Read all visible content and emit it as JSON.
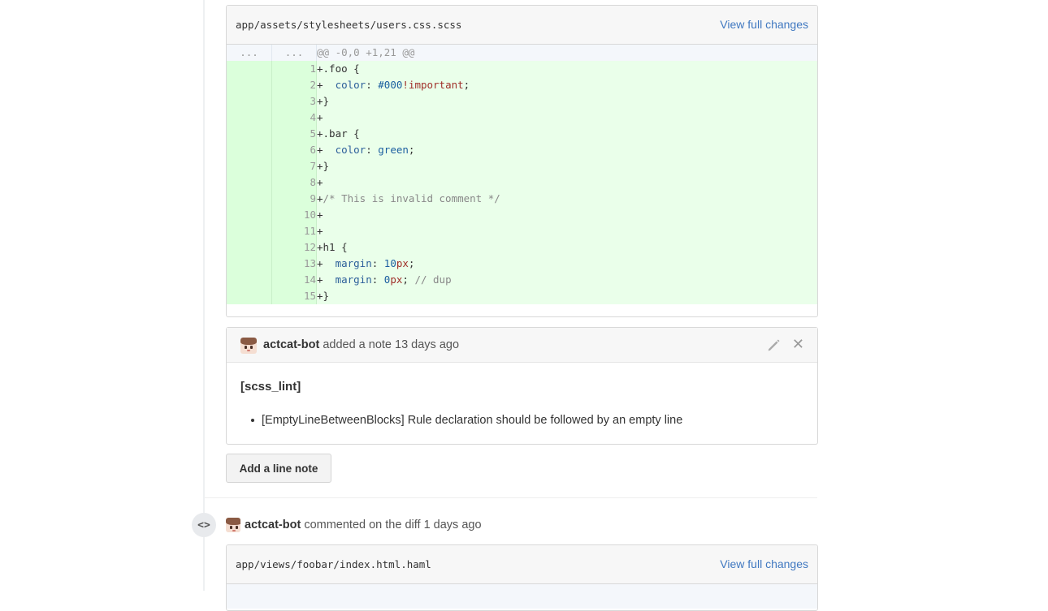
{
  "file1": {
    "path": "app/assets/stylesheets/users.css.scss",
    "view_link": "View full changes",
    "hunk": {
      "old": "...",
      "new": "...",
      "text": "@@ -0,0 +1,21 @@"
    },
    "lines": [
      {
        "num": "1",
        "tokens": [
          {
            "t": "+.foo {",
            "c": ""
          }
        ]
      },
      {
        "num": "2",
        "tokens": [
          {
            "t": "+  ",
            "c": ""
          },
          {
            "t": "color",
            "c": "k"
          },
          {
            "t": ": ",
            "c": ""
          },
          {
            "t": "#000",
            "c": "n"
          },
          {
            "t": "!important",
            "c": "imp"
          },
          {
            "t": ";",
            "c": ""
          }
        ]
      },
      {
        "num": "3",
        "tokens": [
          {
            "t": "+}",
            "c": ""
          }
        ]
      },
      {
        "num": "4",
        "tokens": [
          {
            "t": "+",
            "c": ""
          }
        ]
      },
      {
        "num": "5",
        "tokens": [
          {
            "t": "+.bar {",
            "c": ""
          }
        ]
      },
      {
        "num": "6",
        "tokens": [
          {
            "t": "+  ",
            "c": ""
          },
          {
            "t": "color",
            "c": "k"
          },
          {
            "t": ": ",
            "c": ""
          },
          {
            "t": "green",
            "c": "n"
          },
          {
            "t": ";",
            "c": ""
          }
        ]
      },
      {
        "num": "7",
        "tokens": [
          {
            "t": "+}",
            "c": ""
          }
        ]
      },
      {
        "num": "8",
        "tokens": [
          {
            "t": "+",
            "c": ""
          }
        ]
      },
      {
        "num": "9",
        "tokens": [
          {
            "t": "+",
            "c": ""
          },
          {
            "t": "/* This is invalid comment */",
            "c": "cm"
          }
        ]
      },
      {
        "num": "10",
        "tokens": [
          {
            "t": "+",
            "c": ""
          }
        ]
      },
      {
        "num": "11",
        "tokens": [
          {
            "t": "+",
            "c": ""
          }
        ]
      },
      {
        "num": "12",
        "tokens": [
          {
            "t": "+h1 {",
            "c": ""
          }
        ]
      },
      {
        "num": "13",
        "tokens": [
          {
            "t": "+  ",
            "c": ""
          },
          {
            "t": "margin",
            "c": "k"
          },
          {
            "t": ": ",
            "c": ""
          },
          {
            "t": "10",
            "c": "n"
          },
          {
            "t": "px",
            "c": "imp"
          },
          {
            "t": ";",
            "c": ""
          }
        ]
      },
      {
        "num": "14",
        "tokens": [
          {
            "t": "+  ",
            "c": ""
          },
          {
            "t": "margin",
            "c": "k"
          },
          {
            "t": ": ",
            "c": ""
          },
          {
            "t": "0",
            "c": "n"
          },
          {
            "t": "px",
            "c": "imp"
          },
          {
            "t": "; ",
            "c": ""
          },
          {
            "t": "// dup",
            "c": "cm"
          }
        ]
      },
      {
        "num": "15",
        "tokens": [
          {
            "t": "+}",
            "c": ""
          }
        ]
      }
    ]
  },
  "note": {
    "author": "actcat-bot",
    "action": " added a note 13 days ago",
    "close_glyph": "✕",
    "title": "[scss_lint]",
    "item": "[EmptyLineBetweenBlocks] Rule declaration should be followed by an empty line"
  },
  "add_line_note_label": "Add a line note",
  "comment": {
    "badge": "<>",
    "author": "actcat-bot",
    "action": " commented on the diff 1 days ago"
  },
  "file2": {
    "path": "app/views/foobar/index.html.haml",
    "view_link": "View full changes"
  },
  "colors": {
    "link": "#4078c0",
    "added_line_bg": "#eaffea",
    "added_gutter_bg": "#dbffdb",
    "hunk_bg": "#f4f7fb"
  }
}
